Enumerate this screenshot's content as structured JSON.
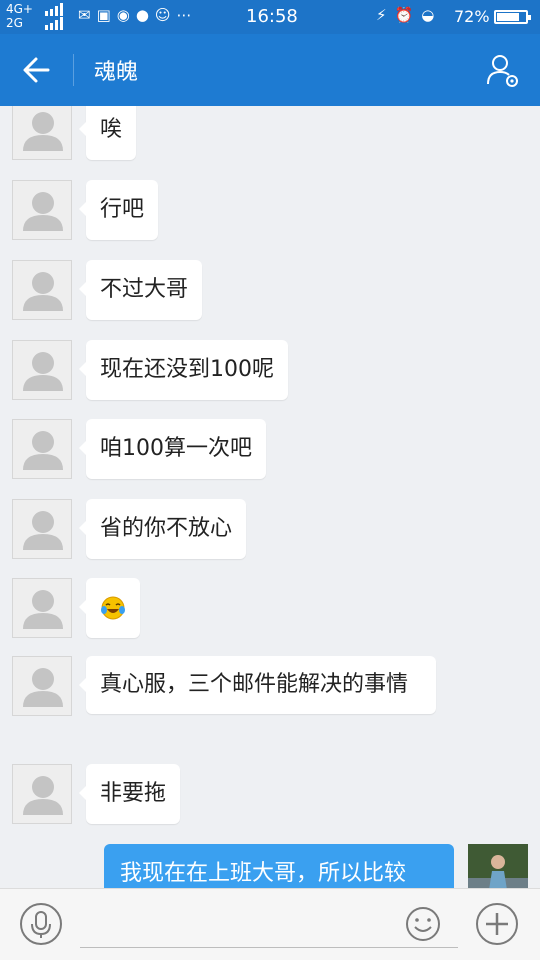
{
  "status_bar": {
    "network_top": "4G+",
    "network_bottom": "2G",
    "time": "16:58",
    "battery_percent_text": "72%",
    "battery_level": 0.72,
    "left_icons": "mail, screenshot, wechat, message, android, more",
    "right_icons": "charge, alarm, wifi"
  },
  "header": {
    "title": "魂魄",
    "back_icon": "arrow-left-icon",
    "profile_icon": "user-settings-icon"
  },
  "messages": [
    {
      "text": "唉"
    },
    {
      "text": "行吧"
    },
    {
      "text": "不过大哥"
    },
    {
      "text": "现在还没到100呢"
    },
    {
      "text": "咱100算一次吧"
    },
    {
      "text": "省的你不放心"
    },
    {
      "emoji": "laughing-tears-emoji"
    },
    {
      "text": "真心服，三个邮件能解决的事情"
    },
    {
      "text": "非要拖"
    }
  ],
  "self_message": {
    "text": "我现在在上班大哥，所以比较"
  },
  "input_bar": {
    "placeholder": "",
    "voice_icon": "microphone-icon",
    "emoji_icon": "smiley-icon",
    "plus_icon": "plus-icon"
  },
  "colors": {
    "header_bg": "#1e7bd2",
    "status_bg": "#1d74c8",
    "self_bubble": "#3aa0f0",
    "chat_bg": "#eef0f3"
  }
}
